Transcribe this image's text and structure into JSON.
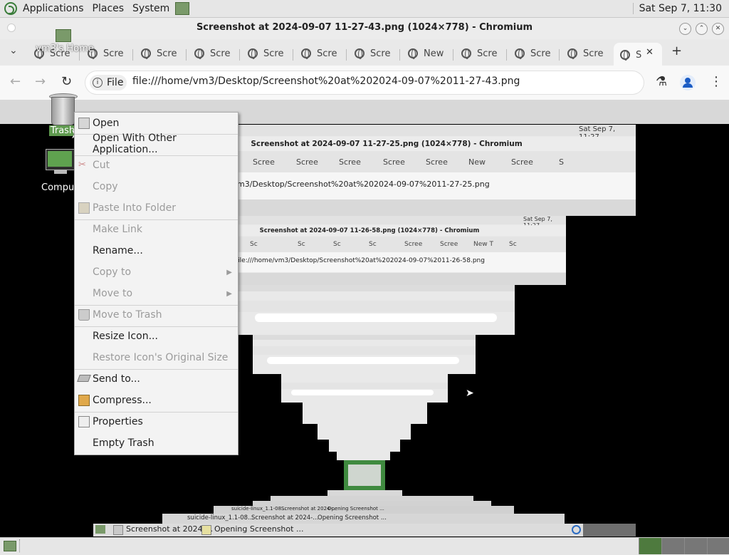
{
  "top_panel": {
    "menus": [
      "Applications",
      "Places",
      "System"
    ],
    "clock": "Sat Sep  7, 11:30"
  },
  "window": {
    "title": "Screenshot at 2024-09-07 11-27-43.png (1024×778) - Chromium",
    "tabs": [
      "Scre",
      "Scre",
      "Scre",
      "Scre",
      "Scre",
      "Scre",
      "Scre",
      "New",
      "Scre",
      "Scre"
    ],
    "active_tab": "S",
    "url_chip": "File",
    "url": "file:///home/vm3/Desktop/Screenshot%20at%202024-09-07%2011-27-43.png"
  },
  "desktop": {
    "icons": {
      "home": "vm3's Home",
      "trash": "Trash",
      "computer": "Computer"
    }
  },
  "nested_1": {
    "clock": "Sat Sep  7, 11:27",
    "title": "Screenshot at 2024-09-07 11-27-25.png (1024×778) - Chromium",
    "tabs": [
      "Scree",
      "Scree",
      "Scree",
      "Scree",
      "Scree",
      "New",
      "Scree",
      "S"
    ],
    "url": "m3/Desktop/Screenshot%20at%202024-09-07%2011-27-25.png"
  },
  "nested_2": {
    "clock": "Sat Sep  7, 11:27",
    "title": "Screenshot at 2024-09-07 11-26-58.png (1024×778) - Chromium",
    "tabs": [
      "Sc",
      "Sc",
      "Sc",
      "Sc",
      "Scree",
      "Scree",
      "New T",
      "Sc"
    ],
    "url": "file:///home/vm3/Desktop/Screenshot%20at%202024-09-07%2011-26-58.png"
  },
  "context_menu": {
    "items": [
      {
        "label": "Open",
        "disabled": false
      },
      {
        "label": "Open With Other Application...",
        "disabled": false
      },
      {
        "label": "Cut",
        "disabled": true
      },
      {
        "label": "Copy",
        "disabled": true
      },
      {
        "label": "Paste Into Folder",
        "disabled": true
      },
      {
        "label": "Make Link",
        "disabled": true
      },
      {
        "label": "Rename...",
        "disabled": false
      },
      {
        "label": "Copy to",
        "disabled": true
      },
      {
        "label": "Move to",
        "disabled": true
      },
      {
        "label": "Move to Trash",
        "disabled": true
      },
      {
        "label": "Resize Icon...",
        "disabled": false
      },
      {
        "label": "Restore Icon's Original Size",
        "disabled": true
      },
      {
        "label": "Send to...",
        "disabled": false
      },
      {
        "label": "Compress...",
        "disabled": false
      },
      {
        "label": "Properties",
        "disabled": false
      },
      {
        "label": "Empty Trash",
        "disabled": false
      }
    ]
  },
  "taskbar": {
    "nested_items": [
      "Screenshot at 2024-...",
      "Opening Screenshot ..."
    ],
    "inner_items": [
      "suicide-linux_1.1-08...",
      "Screenshot at 2024-...",
      "Opening Screenshot ..."
    ]
  }
}
